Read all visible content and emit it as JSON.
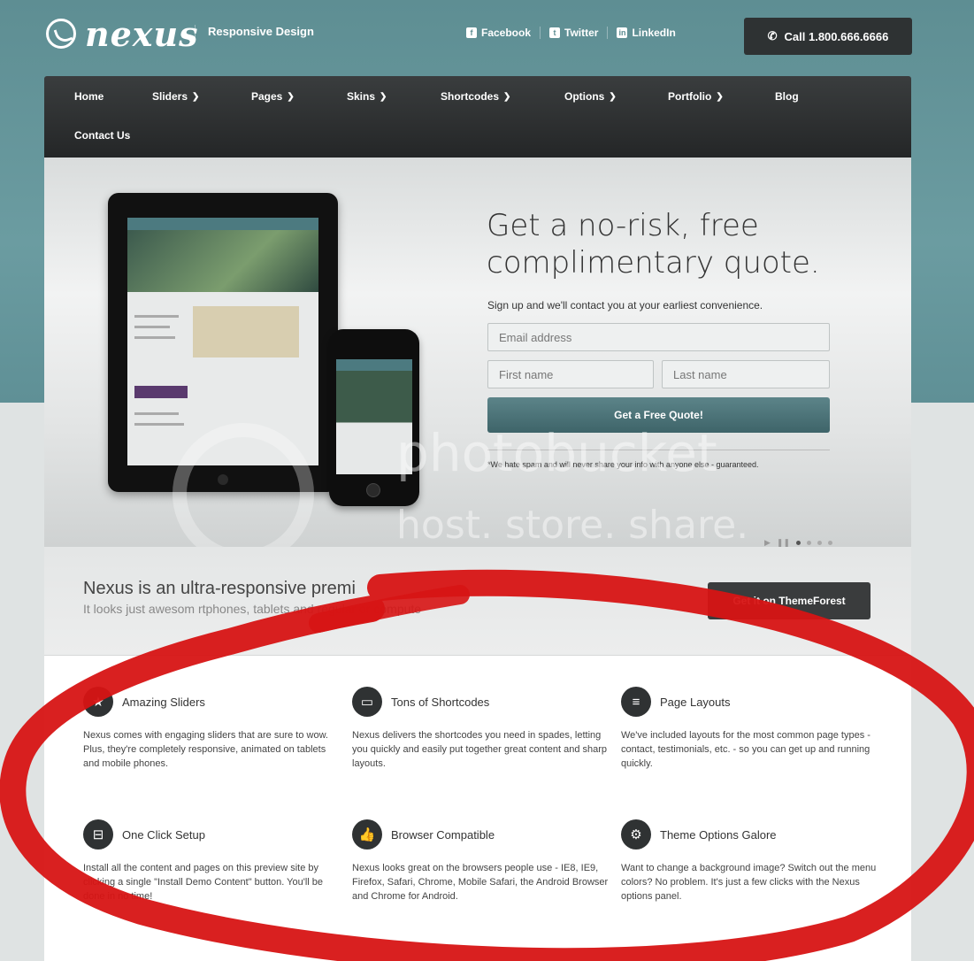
{
  "header": {
    "logo_text": "nexus",
    "tagline": "Responsive Design",
    "social": [
      {
        "label": "Facebook",
        "icon": "facebook-icon"
      },
      {
        "label": "Twitter",
        "icon": "twitter-icon"
      },
      {
        "label": "LinkedIn",
        "icon": "linkedin-icon"
      }
    ],
    "call_label": "Call 1.800.666.6666"
  },
  "nav": {
    "items": [
      {
        "label": "Home",
        "dropdown": false
      },
      {
        "label": "Sliders",
        "dropdown": true
      },
      {
        "label": "Pages",
        "dropdown": true
      },
      {
        "label": "Skins",
        "dropdown": true
      },
      {
        "label": "Shortcodes",
        "dropdown": true
      },
      {
        "label": "Options",
        "dropdown": true
      },
      {
        "label": "Portfolio",
        "dropdown": true
      },
      {
        "label": "Blog",
        "dropdown": false
      },
      {
        "label": "Contact Us",
        "dropdown": false
      }
    ]
  },
  "hero": {
    "title_line1": "Get a no-risk, free",
    "title_line2": "complimentary quote.",
    "subtitle": "Sign up and we'll contact you at your earliest convenience.",
    "email_placeholder": "Email address",
    "first_placeholder": "First name",
    "last_placeholder": "Last name",
    "button_label": "Get a Free Quote!",
    "disclaimer": "*We hate spam and will never share your info with anyone else - guaranteed."
  },
  "watermark": {
    "line1": "photobucket",
    "line2": "host. store. share."
  },
  "promo": {
    "headline": "Nexus is an ultra-responsive premi",
    "subline": "It looks just awesom          rtphones, tablets and regular or compute",
    "button_label": "Get it on ThemeForest"
  },
  "features": [
    {
      "title": "Amazing Sliders",
      "icon": "star-icon",
      "glyph": "★",
      "body": "Nexus comes with engaging sliders that are sure to wow. Plus, they're completely responsive, animated on tablets and mobile phones."
    },
    {
      "title": "Tons of Shortcodes",
      "icon": "box-icon",
      "glyph": "▭",
      "body": "Nexus delivers the shortcodes you need in spades, letting you quickly and easily put together great content and sharp layouts."
    },
    {
      "title": "Page Layouts",
      "icon": "document-icon",
      "glyph": "≡",
      "body": "We've included layouts for the most common page types - contact, testimonials, etc. - so you can get up and running quickly."
    },
    {
      "title": "One Click Setup",
      "icon": "inbox-icon",
      "glyph": "⊟",
      "body": "Install all the content and pages on this preview site by clicking a single \"Install Demo Content\" button. You'll be done in no time!"
    },
    {
      "title": "Browser Compatible",
      "icon": "thumbs-up-icon",
      "glyph": "👍",
      "body": "Nexus looks great on the browsers people use - IE8, IE9, Firefox, Safari, Chrome, Mobile Safari, the Android Browser and Chrome for Android."
    },
    {
      "title": "Theme Options Galore",
      "icon": "gear-icon",
      "glyph": "⚙",
      "body": "Want to change a background image? Switch out the menu colors? No problem. It's just a few clicks with the Nexus options panel."
    }
  ],
  "colors": {
    "teal": "#5e8e93",
    "dark": "#2e3233",
    "marker_red": "#d71414"
  }
}
